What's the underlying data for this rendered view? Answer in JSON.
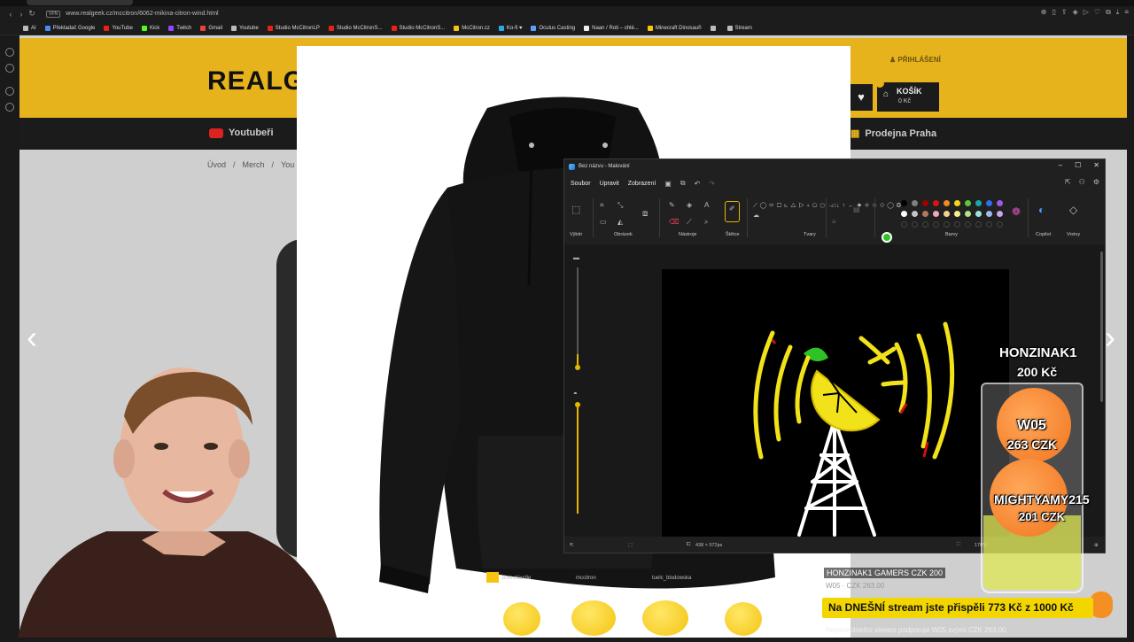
{
  "browser": {
    "url": "www.realgeek.cz/mccitron/6062-mikina-citron-wind.html",
    "vpn_label": "VPN",
    "bookmarks": [
      {
        "label": "AI",
        "color": "#bbbbbb"
      },
      {
        "label": "Překladač Google",
        "color": "#4a8af4"
      },
      {
        "label": "YouTube",
        "color": "#e62117"
      },
      {
        "label": "Kick",
        "color": "#53fc18"
      },
      {
        "label": "Twitch",
        "color": "#9146ff"
      },
      {
        "label": "Gmail",
        "color": "#ea4335"
      },
      {
        "label": "Youtube",
        "color": "#bbbbbb"
      },
      {
        "label": "Studio McCitronLP",
        "color": "#e62117"
      },
      {
        "label": "Studio McCitronS...",
        "color": "#e62117"
      },
      {
        "label": "Studio McCitronS...",
        "color": "#e62117"
      },
      {
        "label": "McCitron.cz",
        "color": "#f4c411"
      },
      {
        "label": "Ko-fi ♥",
        "color": "#29abe0"
      },
      {
        "label": "Oculus Casting",
        "color": "#5aa0ff"
      },
      {
        "label": "Naan / Roti – chlé...",
        "color": "#eeeeee"
      },
      {
        "label": "Minecraft Dinosauři",
        "color": "#f4c411"
      },
      {
        "label": "",
        "color": "#bbbbbb"
      },
      {
        "label": "Stream",
        "color": "#bbbbbb"
      }
    ]
  },
  "site": {
    "logo": "REALGEE",
    "login": "PŘIHLÁŠENÍ",
    "cart_label": "KOŠÍK",
    "cart_price": "0 Kč",
    "nav_youtubers": "Youtubeři",
    "nav_shop": "Prodejna Praha",
    "breadcrumb": [
      "Úvod",
      "/",
      "Merch",
      "/",
      "You"
    ]
  },
  "paint": {
    "title": "Bez názvu - Malování",
    "menu": [
      "Soubor",
      "Upravit",
      "Zobrazení"
    ],
    "groups": {
      "selection": "Výběr",
      "image": "Obrázek",
      "tools": "Nástroje",
      "brushes": "Štětce",
      "shapes": "Tvary",
      "colors": "Barvy",
      "copilot": "Copilot",
      "layers": "Vrstvy"
    },
    "status_size": "438 × 572px",
    "zoom": "178%",
    "primary_color": "#2ec227",
    "secondary_color": "#ffffff",
    "palette": [
      "#000000",
      "#7f7f7f",
      "#a00000",
      "#e01010",
      "#f28a1e",
      "#f5d51a",
      "#5ac83a",
      "#17a8a0",
      "#2f6ef0",
      "#a05ae6",
      "#ffffff",
      "#c3c3c3",
      "#b07a5a",
      "#f0a8b8",
      "#f7d28a",
      "#f7ef8a",
      "#b4e08a",
      "#9ce0e0",
      "#9abaf0",
      "#c8a8e8"
    ]
  },
  "stream": {
    "donors": [
      {
        "name": "HONZINAK1",
        "amount": "200 Kč"
      },
      {
        "name": "W05",
        "amount": "263 CZK"
      },
      {
        "name": "MIGHTYAMY215",
        "amount": "201 CZK"
      }
    ],
    "latest_alert": "HONZINAK1 GAMERS  CZK 200",
    "latest_sub": "W05 · CZK 263.00",
    "total_banner": "Na DNEŠNÍ stream jste přispěli 773 Kč z 1000 Kč",
    "ticker": "Nejvíce dnešní stream podporuje W05 svými CZK 263.00",
    "goal_progress": 0.773,
    "emote_labels": [
      "zlme.claudie",
      "mccitron",
      "tuelc_blodowska"
    ]
  }
}
